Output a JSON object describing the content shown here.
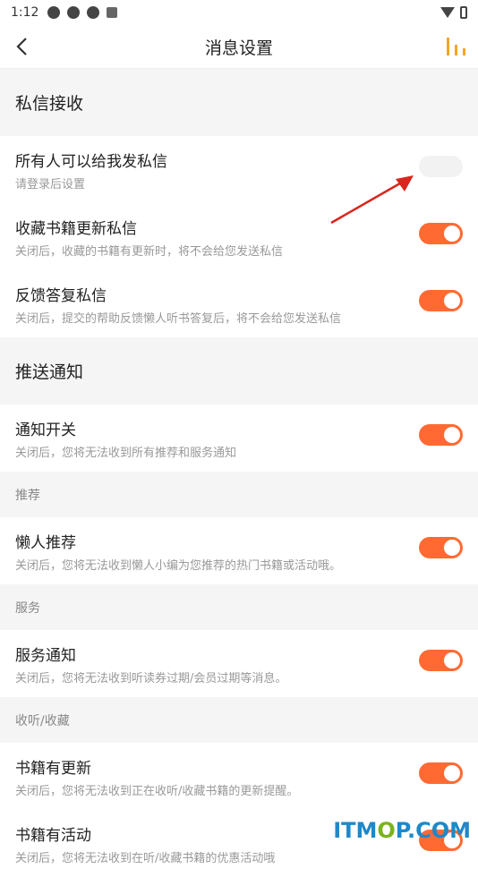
{
  "status": {
    "time": "1:12"
  },
  "nav": {
    "title": "消息设置"
  },
  "sections": {
    "private": "私信接收",
    "push": "推送通知"
  },
  "rows": {
    "everyone": {
      "title": "所有人可以给我发私信",
      "desc": "请登录后设置",
      "on": false
    },
    "fav_update": {
      "title": "收藏书籍更新私信",
      "desc": "关闭后，收藏的书籍有更新时，将不会给您发送私信",
      "on": true
    },
    "feedback": {
      "title": "反馈答复私信",
      "desc": "关闭后，提交的帮助反馈懒人听书答复后，将不会给您发送私信",
      "on": true
    },
    "notify": {
      "title": "通知开关",
      "desc": "关闭后，您将无法收到所有推荐和服务通知",
      "on": true
    },
    "lazy_rec": {
      "title": "懒人推荐",
      "desc": "关闭后，您将无法收到懒人小编为您推荐的热门书籍或活动哦。",
      "on": true
    },
    "service": {
      "title": "服务通知",
      "desc": "关闭后，您将无法收到听读券过期/会员过期等消息。",
      "on": true
    },
    "book_update": {
      "title": "书籍有更新",
      "desc": "关闭后，您将无法收到正在收听/收藏书籍的更新提醒。",
      "on": true
    },
    "book_activity": {
      "title": "书籍有活动",
      "desc": "关闭后，您将无法收到在听/收藏书籍的优惠活动哦",
      "on": true
    }
  },
  "subheaders": {
    "recommend": "推荐",
    "service": "服务",
    "listen": "收听/收藏"
  },
  "watermark": {
    "a": "ITM",
    "b": "O",
    "c": "P.COM"
  },
  "colors": {
    "accent": "#ff6a33"
  }
}
